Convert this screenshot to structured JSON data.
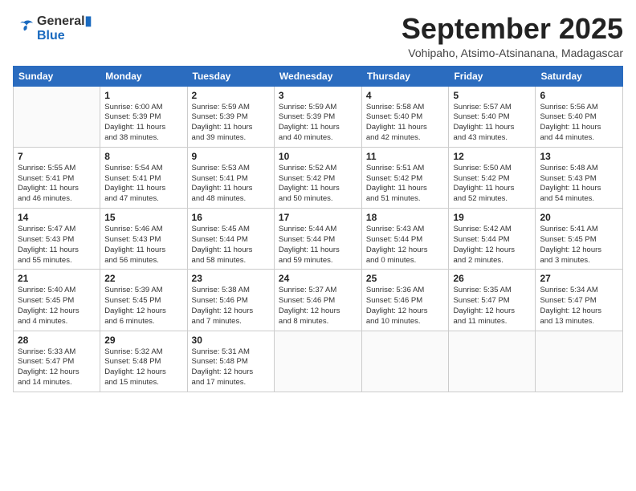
{
  "logo": {
    "line1": "General",
    "line2": "Blue"
  },
  "title": "September 2025",
  "subtitle": "Vohipaho, Atsimo-Atsinanana, Madagascar",
  "days_of_week": [
    "Sunday",
    "Monday",
    "Tuesday",
    "Wednesday",
    "Thursday",
    "Friday",
    "Saturday"
  ],
  "weeks": [
    [
      {
        "day": "",
        "info": ""
      },
      {
        "day": "1",
        "info": "Sunrise: 6:00 AM\nSunset: 5:39 PM\nDaylight: 11 hours\nand 38 minutes."
      },
      {
        "day": "2",
        "info": "Sunrise: 5:59 AM\nSunset: 5:39 PM\nDaylight: 11 hours\nand 39 minutes."
      },
      {
        "day": "3",
        "info": "Sunrise: 5:59 AM\nSunset: 5:39 PM\nDaylight: 11 hours\nand 40 minutes."
      },
      {
        "day": "4",
        "info": "Sunrise: 5:58 AM\nSunset: 5:40 PM\nDaylight: 11 hours\nand 42 minutes."
      },
      {
        "day": "5",
        "info": "Sunrise: 5:57 AM\nSunset: 5:40 PM\nDaylight: 11 hours\nand 43 minutes."
      },
      {
        "day": "6",
        "info": "Sunrise: 5:56 AM\nSunset: 5:40 PM\nDaylight: 11 hours\nand 44 minutes."
      }
    ],
    [
      {
        "day": "7",
        "info": "Sunrise: 5:55 AM\nSunset: 5:41 PM\nDaylight: 11 hours\nand 46 minutes."
      },
      {
        "day": "8",
        "info": "Sunrise: 5:54 AM\nSunset: 5:41 PM\nDaylight: 11 hours\nand 47 minutes."
      },
      {
        "day": "9",
        "info": "Sunrise: 5:53 AM\nSunset: 5:41 PM\nDaylight: 11 hours\nand 48 minutes."
      },
      {
        "day": "10",
        "info": "Sunrise: 5:52 AM\nSunset: 5:42 PM\nDaylight: 11 hours\nand 50 minutes."
      },
      {
        "day": "11",
        "info": "Sunrise: 5:51 AM\nSunset: 5:42 PM\nDaylight: 11 hours\nand 51 minutes."
      },
      {
        "day": "12",
        "info": "Sunrise: 5:50 AM\nSunset: 5:42 PM\nDaylight: 11 hours\nand 52 minutes."
      },
      {
        "day": "13",
        "info": "Sunrise: 5:48 AM\nSunset: 5:43 PM\nDaylight: 11 hours\nand 54 minutes."
      }
    ],
    [
      {
        "day": "14",
        "info": "Sunrise: 5:47 AM\nSunset: 5:43 PM\nDaylight: 11 hours\nand 55 minutes."
      },
      {
        "day": "15",
        "info": "Sunrise: 5:46 AM\nSunset: 5:43 PM\nDaylight: 11 hours\nand 56 minutes."
      },
      {
        "day": "16",
        "info": "Sunrise: 5:45 AM\nSunset: 5:44 PM\nDaylight: 11 hours\nand 58 minutes."
      },
      {
        "day": "17",
        "info": "Sunrise: 5:44 AM\nSunset: 5:44 PM\nDaylight: 11 hours\nand 59 minutes."
      },
      {
        "day": "18",
        "info": "Sunrise: 5:43 AM\nSunset: 5:44 PM\nDaylight: 12 hours\nand 0 minutes."
      },
      {
        "day": "19",
        "info": "Sunrise: 5:42 AM\nSunset: 5:44 PM\nDaylight: 12 hours\nand 2 minutes."
      },
      {
        "day": "20",
        "info": "Sunrise: 5:41 AM\nSunset: 5:45 PM\nDaylight: 12 hours\nand 3 minutes."
      }
    ],
    [
      {
        "day": "21",
        "info": "Sunrise: 5:40 AM\nSunset: 5:45 PM\nDaylight: 12 hours\nand 4 minutes."
      },
      {
        "day": "22",
        "info": "Sunrise: 5:39 AM\nSunset: 5:45 PM\nDaylight: 12 hours\nand 6 minutes."
      },
      {
        "day": "23",
        "info": "Sunrise: 5:38 AM\nSunset: 5:46 PM\nDaylight: 12 hours\nand 7 minutes."
      },
      {
        "day": "24",
        "info": "Sunrise: 5:37 AM\nSunset: 5:46 PM\nDaylight: 12 hours\nand 8 minutes."
      },
      {
        "day": "25",
        "info": "Sunrise: 5:36 AM\nSunset: 5:46 PM\nDaylight: 12 hours\nand 10 minutes."
      },
      {
        "day": "26",
        "info": "Sunrise: 5:35 AM\nSunset: 5:47 PM\nDaylight: 12 hours\nand 11 minutes."
      },
      {
        "day": "27",
        "info": "Sunrise: 5:34 AM\nSunset: 5:47 PM\nDaylight: 12 hours\nand 13 minutes."
      }
    ],
    [
      {
        "day": "28",
        "info": "Sunrise: 5:33 AM\nSunset: 5:47 PM\nDaylight: 12 hours\nand 14 minutes."
      },
      {
        "day": "29",
        "info": "Sunrise: 5:32 AM\nSunset: 5:48 PM\nDaylight: 12 hours\nand 15 minutes."
      },
      {
        "day": "30",
        "info": "Sunrise: 5:31 AM\nSunset: 5:48 PM\nDaylight: 12 hours\nand 17 minutes."
      },
      {
        "day": "",
        "info": ""
      },
      {
        "day": "",
        "info": ""
      },
      {
        "day": "",
        "info": ""
      },
      {
        "day": "",
        "info": ""
      }
    ]
  ]
}
